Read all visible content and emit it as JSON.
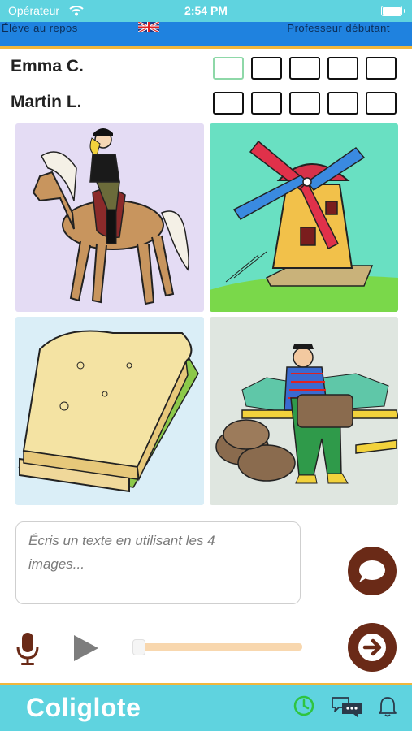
{
  "status_bar": {
    "carrier": "Opérateur",
    "time": "2:54 PM"
  },
  "header": {
    "level_left": "Élève au repos",
    "level_right": "Professeur débutant"
  },
  "players": [
    {
      "name": "Emma C.",
      "boxes_total": 5,
      "active_box": 1
    },
    {
      "name": "Martin L.",
      "boxes_total": 5,
      "active_box": 0
    }
  ],
  "images": [
    {
      "name": "horse-rider-image",
      "bg": "#e4dcf4"
    },
    {
      "name": "windmill-image",
      "bg": "#69e0c2"
    },
    {
      "name": "sandwich-image",
      "bg": "#daeef7"
    },
    {
      "name": "fisherman-image",
      "bg": "#dfe6e0"
    }
  ],
  "composer": {
    "placeholder": "Écris un texte en utilisant les 4 images..."
  },
  "audio": {
    "progress": 0.0
  },
  "bottom_bar": {
    "logo": "Coliglote"
  },
  "colors": {
    "accent_cyan": "#5fd3df",
    "accent_blue": "#1f82df",
    "accent_gold": "#f1b73c",
    "button_brown": "#6a2a17",
    "icon_green": "#2ec440"
  }
}
